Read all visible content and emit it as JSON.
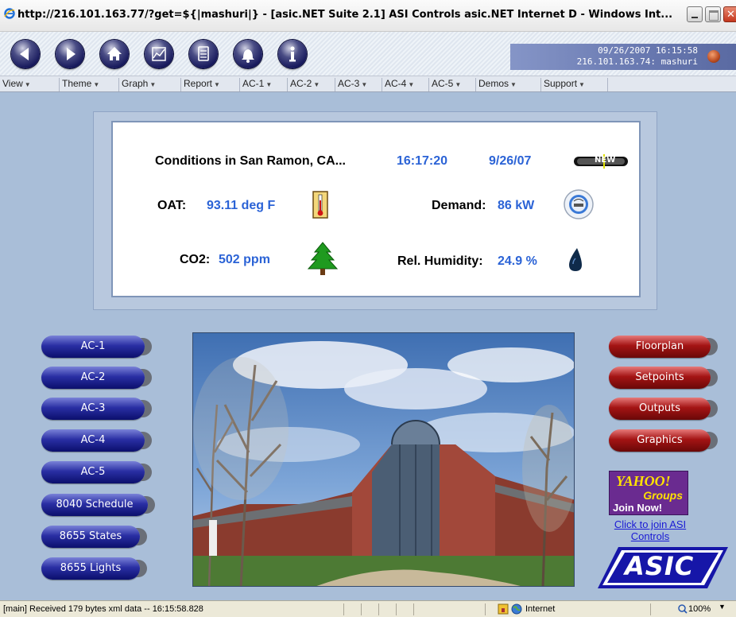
{
  "window": {
    "title": "http://216.101.163.77/?get=${|mashuri|} - [asic.NET Suite 2.1] ASI Controls asic.NET Internet D - Windows Int..."
  },
  "toolbar": {
    "buttons": [
      "back-icon",
      "forward-icon",
      "home-icon",
      "graph-icon",
      "report-icon",
      "alarm-bell-icon",
      "info-icon"
    ],
    "datetime": "09/26/2007 16:15:58",
    "session": "216.101.163.74: mashuri"
  },
  "menu": {
    "items": [
      {
        "label": "View"
      },
      {
        "label": "Theme"
      },
      {
        "label": "Graph"
      },
      {
        "label": "Report"
      },
      {
        "label": "AC-1"
      },
      {
        "label": "AC-2"
      },
      {
        "label": "AC-3"
      },
      {
        "label": "AC-4"
      },
      {
        "label": "AC-5"
      },
      {
        "label": "Demos"
      },
      {
        "label": "Support"
      }
    ]
  },
  "conditions": {
    "heading": "Conditions in San Ramon, CA...",
    "time": "16:17:20",
    "date": "9/26/07",
    "new_badge": "NEW",
    "oat_label": "OAT:",
    "oat_value": "93.11 deg F",
    "demand_label": "Demand:",
    "demand_value": "86 kW",
    "co2_label": "CO2:",
    "co2_value": "502 ppm",
    "humidity_label": "Rel. Humidity:",
    "humidity_value": "24.9 %"
  },
  "left_buttons": [
    "AC-1",
    "AC-2",
    "AC-3",
    "AC-4",
    "AC-5",
    "8040 Schedule",
    "8655 States",
    "8655 Lights"
  ],
  "right_buttons": [
    "Floorplan",
    "Setpoints",
    "Outputs",
    "Graphics"
  ],
  "yahoo": {
    "brand": "YAHOO!",
    "sub": "Groups",
    "cta": "Join Now!",
    "link": "Click to join ASI Controls"
  },
  "logo": {
    "text": "ASIC"
  },
  "status": {
    "message": "[main] Received 179 bytes xml data -- 16:15:58.828",
    "zone": "Internet",
    "zoom": "100%"
  },
  "colors": {
    "background": "#a9bed8",
    "value_blue": "#2b63d6",
    "button_blue": "#1a1f8a",
    "button_red": "#a41414"
  }
}
